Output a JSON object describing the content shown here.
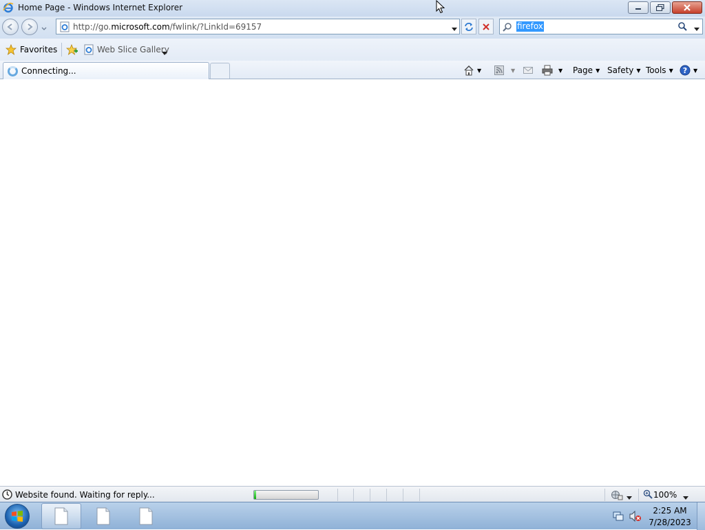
{
  "window": {
    "title": "Home Page - Windows Internet Explorer"
  },
  "navbar": {
    "url_prefix": "http://go.",
    "url_domain": "microsoft.com",
    "url_path": "/fwlink/?LinkId=69157",
    "search_value": "firefox"
  },
  "favbar": {
    "favorites_label": "Favorites",
    "web_slice_label": "Web Slice Gallery"
  },
  "tab": {
    "label": "Connecting..."
  },
  "commands": {
    "page": "Page",
    "safety": "Safety",
    "tools": "Tools"
  },
  "status": {
    "text": "Website found. Waiting for reply...",
    "progress": 0.03,
    "zoom": "100%"
  },
  "taskbar": {
    "time": "2:25 AM",
    "date": "7/28/2023"
  },
  "colors": {
    "selection": "#3399ff",
    "progress_fill": "#10b010",
    "close_button": "#c6402b"
  }
}
